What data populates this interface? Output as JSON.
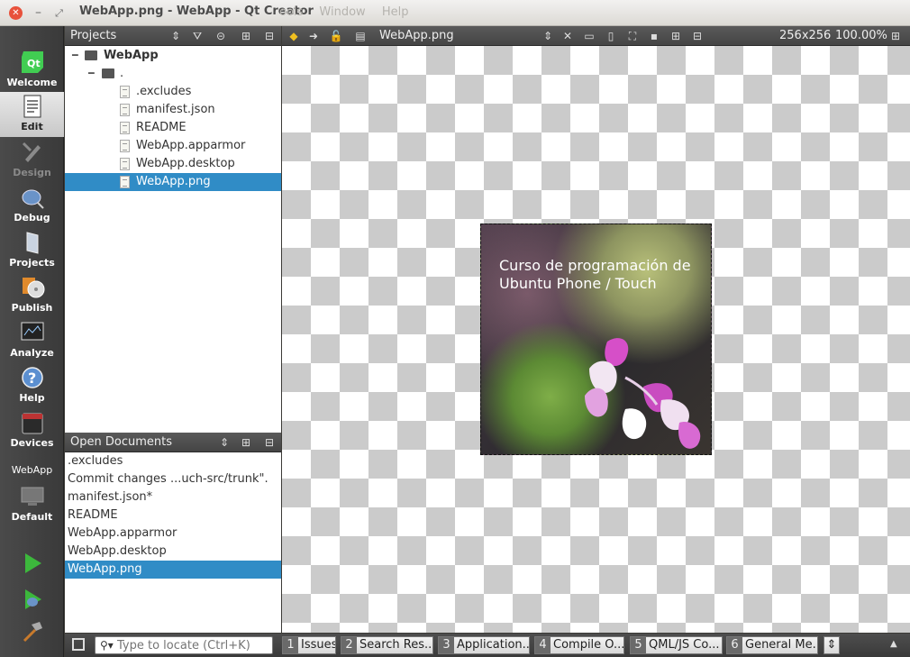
{
  "window": {
    "title": "WebApp.png - WebApp - Qt Creator",
    "menu_ghost": "ools  Window  Help"
  },
  "modes": [
    {
      "label": "Welcome",
      "icon": "qt-logo-icon"
    },
    {
      "label": "Edit",
      "icon": "edit-document-icon"
    },
    {
      "label": "Design",
      "icon": "design-brush-icon"
    },
    {
      "label": "Debug",
      "icon": "debug-bug-icon"
    },
    {
      "label": "Projects",
      "icon": "projects-binder-icon"
    },
    {
      "label": "Publish",
      "icon": "publish-disc-icon"
    },
    {
      "label": "Analyze",
      "icon": "analyze-monitor-icon"
    },
    {
      "label": "Help",
      "icon": "help-question-icon"
    },
    {
      "label": "Devices",
      "icon": "devices-phone-icon"
    }
  ],
  "kit": {
    "project": "WebApp",
    "build": "Default"
  },
  "projects_pane": {
    "title": "Projects",
    "tree": [
      {
        "label": "WebApp",
        "type": "project",
        "depth": 0
      },
      {
        "label": ".",
        "type": "folder",
        "depth": 1
      },
      {
        "label": ".excludes",
        "type": "file",
        "depth": 2
      },
      {
        "label": "manifest.json",
        "type": "file",
        "depth": 2
      },
      {
        "label": "README",
        "type": "file",
        "depth": 2
      },
      {
        "label": "WebApp.apparmor",
        "type": "file",
        "depth": 2
      },
      {
        "label": "WebApp.desktop",
        "type": "file",
        "depth": 2
      },
      {
        "label": "WebApp.png",
        "type": "file",
        "depth": 2,
        "selected": true
      }
    ]
  },
  "open_documents": {
    "title": "Open Documents",
    "items": [
      ".excludes",
      "Commit changes ...uch-src/trunk\".",
      "manifest.json*",
      "README",
      "WebApp.apparmor",
      "WebApp.desktop",
      "WebApp.png"
    ],
    "selected_index": 6
  },
  "editor": {
    "file": "WebApp.png",
    "size": "256x256",
    "zoom": "100.00%",
    "image_caption": "Curso de programación de Ubuntu Phone / Touch"
  },
  "bottom": {
    "locator_placeholder": "Type to locate (Ctrl+K)",
    "tabs": [
      {
        "num": "1",
        "label": "Issues"
      },
      {
        "num": "2",
        "label": "Search Res..."
      },
      {
        "num": "3",
        "label": "Application..."
      },
      {
        "num": "4",
        "label": "Compile O..."
      },
      {
        "num": "5",
        "label": "QML/JS Co..."
      },
      {
        "num": "6",
        "label": "General Me..."
      }
    ]
  }
}
